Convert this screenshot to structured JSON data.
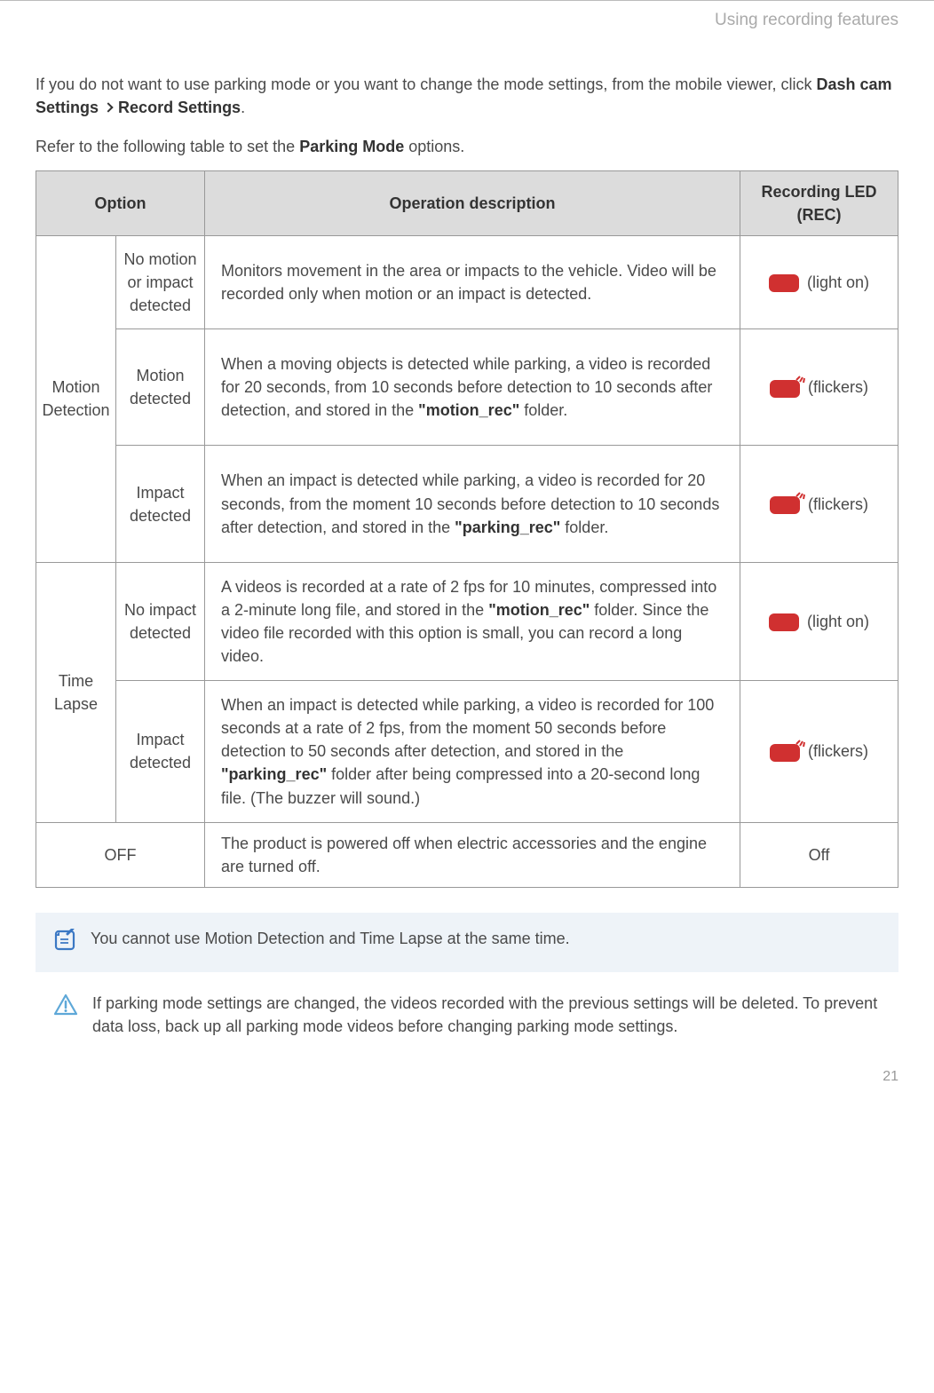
{
  "header": {
    "section_title": "Using recording features"
  },
  "intro": {
    "prefix": "If you do not want to use parking mode or you want to change the mode settings, from the mobile viewer, click ",
    "bold1": "Dash cam Settings",
    "bold2": "Record Settings",
    "suffix": "."
  },
  "refer": {
    "prefix": "Refer to the following table to set the ",
    "bold": "Parking Mode",
    "suffix": " options."
  },
  "table": {
    "headers": {
      "option": "Option",
      "description": "Operation description",
      "led": "Recording LED (REC)"
    },
    "motion_detection": {
      "label": "Motion Detection",
      "rows": {
        "r1": {
          "sub": "No motion or impact detected",
          "desc": "Monitors movement in the area or impacts to the vehicle. Video will be recorded only when motion or an impact is detected.",
          "led": "(light on)"
        },
        "r2": {
          "sub": "Motion detected",
          "desc_pre": "When a moving objects is detected while parking, a video is recorded for 20 seconds, from 10 seconds before detection to 10 seconds after detection, and stored in the ",
          "desc_bold": "\"motion_rec\"",
          "desc_post": " folder.",
          "led": "(flickers)"
        },
        "r3": {
          "sub": "Impact detected",
          "desc_pre": "When an impact is detected while parking, a video is recorded for 20 seconds, from the moment 10 seconds before detection to 10 seconds after detection, and stored in the ",
          "desc_bold": "\"parking_rec\"",
          "desc_post": " folder.",
          "led": "(flickers)"
        }
      }
    },
    "time_lapse": {
      "label": "Time Lapse",
      "rows": {
        "r1": {
          "sub": "No impact detected",
          "desc_pre": "A videos is recorded at a rate of 2 fps for 10 minutes, compressed into a 2-minute long file, and stored in the ",
          "desc_bold": "\"motion_rec\"",
          "desc_post": " folder. Since the video file recorded with this option is small, you can record a long video.",
          "led": "(light on)"
        },
        "r2": {
          "sub": "Impact detected",
          "desc_pre": "When an impact is detected while parking, a video is recorded for 100 seconds at a rate of 2 fps, from the moment 50 seconds before detection to 50 seconds after detection, and stored in the ",
          "desc_bold": "\"parking_rec\"",
          "desc_post": " folder after being compressed into a 20-second long file. (The buzzer will sound.)",
          "led": "(flickers)"
        }
      }
    },
    "off": {
      "label": "OFF",
      "desc": "The product is powered off when electric accessories and the engine are turned off.",
      "led": "Off"
    }
  },
  "note": {
    "text": "You cannot use Motion Detection and Time Lapse at the same time."
  },
  "warning": {
    "text": "If parking mode settings are changed, the videos recorded with the previous settings will be deleted. To prevent data loss, back up all parking mode videos before changing parking mode settings."
  },
  "page_number": "21"
}
